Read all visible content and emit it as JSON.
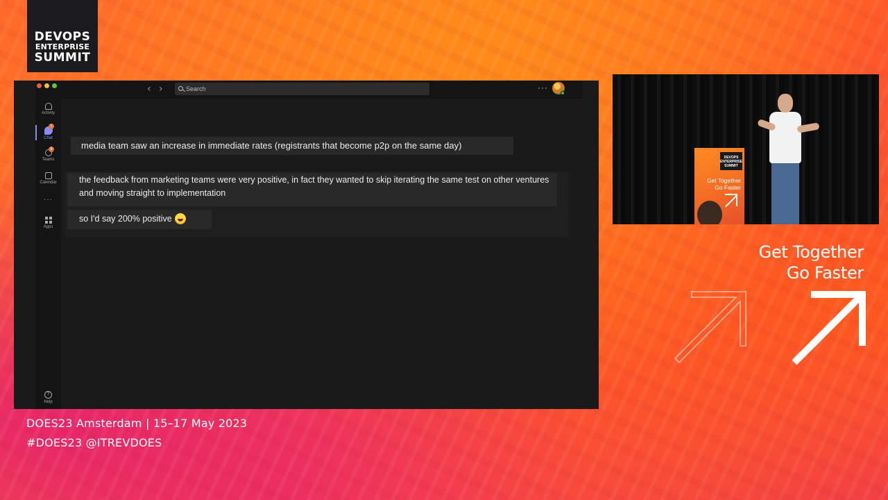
{
  "logo": {
    "line1": "DEVOPS",
    "line2": "ENTERPRISE",
    "line3": "SUMMIT"
  },
  "teams_window": {
    "search_placeholder": "Search",
    "rail": {
      "items": [
        {
          "label": "Activity",
          "icon": "bell-icon"
        },
        {
          "label": "Chat",
          "icon": "chat-icon",
          "badge": "1",
          "active": true
        },
        {
          "label": "Teams",
          "icon": "teams-icon",
          "badge": "8"
        },
        {
          "label": "Calendar",
          "icon": "calendar-icon"
        },
        {
          "label": "Apps",
          "icon": "apps-icon"
        }
      ],
      "more": "···",
      "help": "Help"
    },
    "messages": [
      {
        "text": "media team saw an increase in immediate rates (registrants that become p2p on the same day)"
      },
      {
        "text": "the feedback from marketing teams were very positive, in fact they wanted to skip iterating the same test on other ventures and moving straight to implementation"
      },
      {
        "text": "so I'd say 200% positive",
        "emoji": "grinning-squinting-face"
      }
    ]
  },
  "video_banner": {
    "logo_line1": "DEVOPS",
    "logo_line2": "ENTERPRISE",
    "logo_line3": "SUMMIT",
    "slogan_line1": "Get Together",
    "slogan_line2": "Go Faster"
  },
  "slogan": {
    "line1": "Get Together",
    "line2": "Go Faster"
  },
  "footer": {
    "event": "DOES23 Amsterdam  |  15–17 May 2023",
    "tags": "#DOES23  @ITREVDOES"
  },
  "colors": {
    "accent_purple": "#8b8cf0",
    "badge_orange": "#e0733a",
    "window_bg": "#1a1a1a",
    "bubble_bg": "#292929"
  }
}
